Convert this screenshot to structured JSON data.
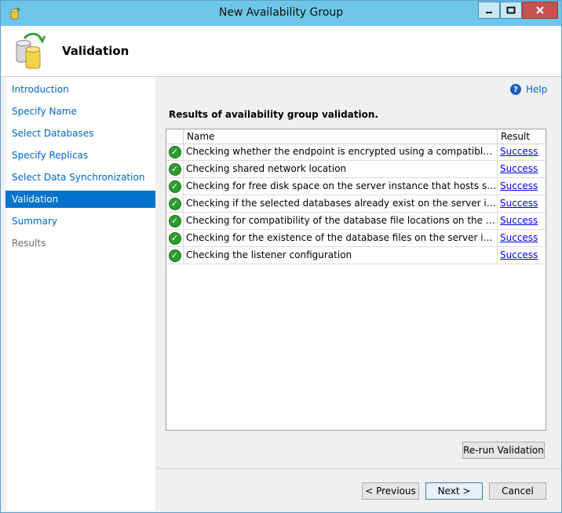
{
  "window": {
    "title": "New Availability Group",
    "controls": {
      "minimize": "minimize",
      "maximize": "maximize",
      "close": "close"
    }
  },
  "header": {
    "title": "Validation"
  },
  "nav": {
    "items": [
      {
        "label": "Introduction",
        "state": "link"
      },
      {
        "label": "Specify Name",
        "state": "link"
      },
      {
        "label": "Select Databases",
        "state": "link"
      },
      {
        "label": "Specify Replicas",
        "state": "link"
      },
      {
        "label": "Select Data Synchronization",
        "state": "link"
      },
      {
        "label": "Validation",
        "state": "active"
      },
      {
        "label": "Summary",
        "state": "link"
      },
      {
        "label": "Results",
        "state": "disabled"
      }
    ]
  },
  "main": {
    "help_label": "Help",
    "results_title": "Results of availability group validation.",
    "columns": {
      "name": "Name",
      "result": "Result"
    },
    "rows": [
      {
        "name": "Checking whether the endpoint is encrypted using a compatible algorith...",
        "result": "Success"
      },
      {
        "name": "Checking shared network location",
        "result": "Success"
      },
      {
        "name": "Checking for free disk space on the server instance that hosts secondary ...",
        "result": "Success"
      },
      {
        "name": "Checking if the selected databases already exist on the server instance th...",
        "result": "Success"
      },
      {
        "name": "Checking for compatibility of the database file locations on the server in...",
        "result": "Success"
      },
      {
        "name": "Checking for the existence of the database files on the server instance th...",
        "result": "Success"
      },
      {
        "name": "Checking the listener configuration",
        "result": "Success"
      }
    ],
    "rerun_label": "Re-run Validation"
  },
  "footer": {
    "previous_label": "< Previous",
    "next_label": "Next >",
    "cancel_label": "Cancel"
  },
  "colors": {
    "titlebar": "#6cc6e6",
    "nav_active": "#0074cc",
    "link": "#0066cc",
    "success_icon": "#2e9b2e"
  }
}
